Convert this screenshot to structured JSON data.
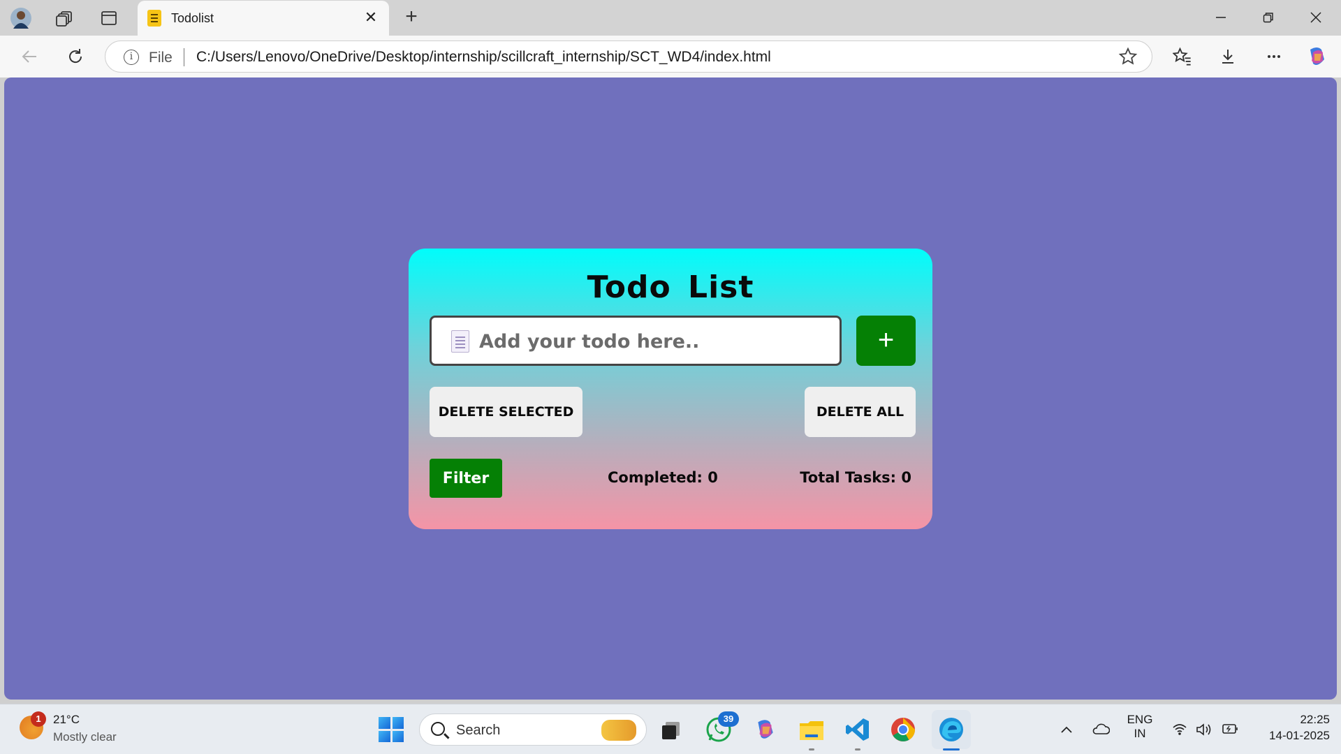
{
  "browser": {
    "tab_title": "Todolist",
    "url_scheme": "File",
    "url": "C:/Users/Lenovo/OneDrive/Desktop/internship/scillcraft_internship/SCT_WD4/index.html",
    "tab_close_glyph": "✕",
    "new_tab_glyph": "+"
  },
  "page": {
    "background_color": "#7070bd",
    "title": "Todo  List",
    "input_placeholder": "Add your todo here..",
    "add_button_label": "+",
    "delete_selected_label": "DELETE SELECTED",
    "delete_all_label": "DELETE ALL",
    "filter_label": "Filter",
    "completed_label": "Completed: 0",
    "total_label": "Total Tasks: 0",
    "accent_color": "#058005"
  },
  "taskbar": {
    "weather_badge": "1",
    "weather_temp": "21°C",
    "weather_desc": "Mostly clear",
    "search_text": "Search",
    "whatsapp_badge": "39",
    "lang_line1": "ENG",
    "lang_line2": "IN",
    "time": "22:25",
    "date": "14-01-2025"
  }
}
